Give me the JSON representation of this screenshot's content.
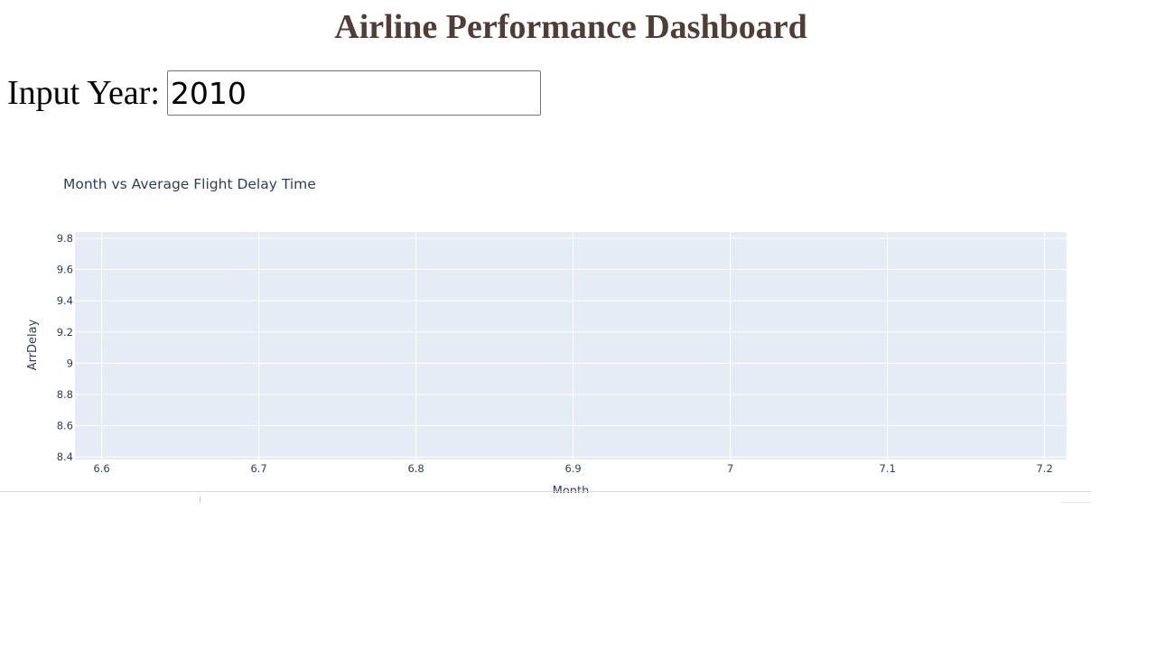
{
  "page": {
    "title": "Airline Performance Dashboard"
  },
  "year_input": {
    "label": "Input Year:",
    "value": "2010"
  },
  "colors": {
    "title": "#503D36",
    "plot_background": "#E5ECF6",
    "grid": "#ffffff",
    "axis_text": "#2a3f5f"
  },
  "chart_data": {
    "type": "line",
    "title": "Month vs Average Flight Delay Time",
    "xlabel": "Month",
    "ylabel": "ArrDelay",
    "xlim": [
      6.583,
      7.214
    ],
    "ylim": [
      8.384,
      9.84
    ],
    "x_ticks": [
      6.6,
      6.7,
      6.8,
      6.9,
      7,
      7.1,
      7.2
    ],
    "y_ticks": [
      8.4,
      8.6,
      8.8,
      9,
      9.2,
      9.4,
      9.6,
      9.8
    ],
    "x_tick_labels": [
      "6.6",
      "6.7",
      "6.8",
      "6.9",
      "7",
      "7.1",
      "7.2"
    ],
    "y_tick_labels": [
      "8.4",
      "8.6",
      "8.8",
      "9",
      "9.2",
      "9.4",
      "9.6",
      "9.8"
    ],
    "grid": true,
    "series": []
  }
}
